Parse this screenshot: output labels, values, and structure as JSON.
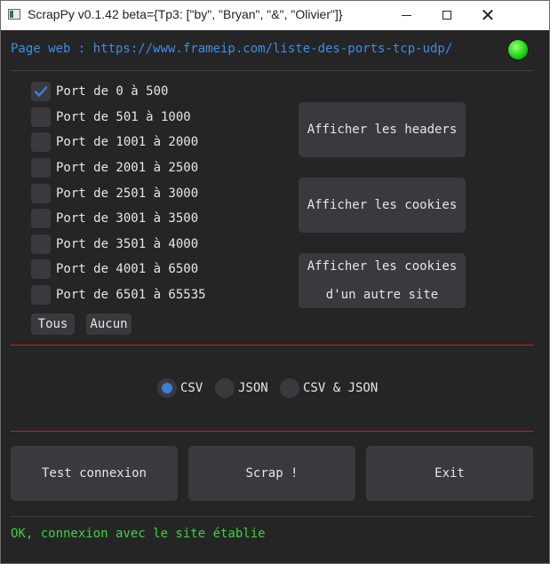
{
  "window": {
    "title": "ScrapPy v0.1.42 beta={Tp3: [\"by\", \"Bryan\", \"&\", \"Olivier\"]}"
  },
  "header": {
    "url_text": "Page web : https://www.frameip.com/liste-des-ports-tcp-udp/",
    "led_color": "#2fe024"
  },
  "ports": {
    "items": [
      {
        "label": "Port de 0 à 500",
        "checked": true
      },
      {
        "label": "Port de 501 à 1000",
        "checked": false
      },
      {
        "label": "Port de 1001 à 2000",
        "checked": false
      },
      {
        "label": "Port de 2001 à 2500",
        "checked": false
      },
      {
        "label": "Port de 2501 à 3000",
        "checked": false
      },
      {
        "label": "Port de 3001 à 3500",
        "checked": false
      },
      {
        "label": "Port de 3501 à 4000",
        "checked": false
      },
      {
        "label": "Port de 4001 à 6500",
        "checked": false
      },
      {
        "label": "Port de 6501 à 65535",
        "checked": false
      }
    ],
    "all_label": "Tous",
    "none_label": "Aucun"
  },
  "side_buttons": {
    "headers_label": "Afficher les headers",
    "cookies_label": "Afficher les cookies",
    "other_cookies_line1": "Afficher les cookies",
    "other_cookies_line2": "d'un autre site"
  },
  "format": {
    "options": [
      {
        "label": "CSV",
        "selected": true
      },
      {
        "label": "JSON",
        "selected": false
      },
      {
        "label": "CSV & JSON",
        "selected": false
      }
    ]
  },
  "actions": {
    "test_label": "Test connexion",
    "scrap_label": "Scrap !",
    "exit_label": "Exit"
  },
  "status": {
    "text": "OK, connexion avec le site établie",
    "color": "#3ed23e"
  },
  "colors": {
    "accent": "#3b8ee8",
    "separator_red": "#c81e1e",
    "check_blue": "#3b7fd6"
  }
}
